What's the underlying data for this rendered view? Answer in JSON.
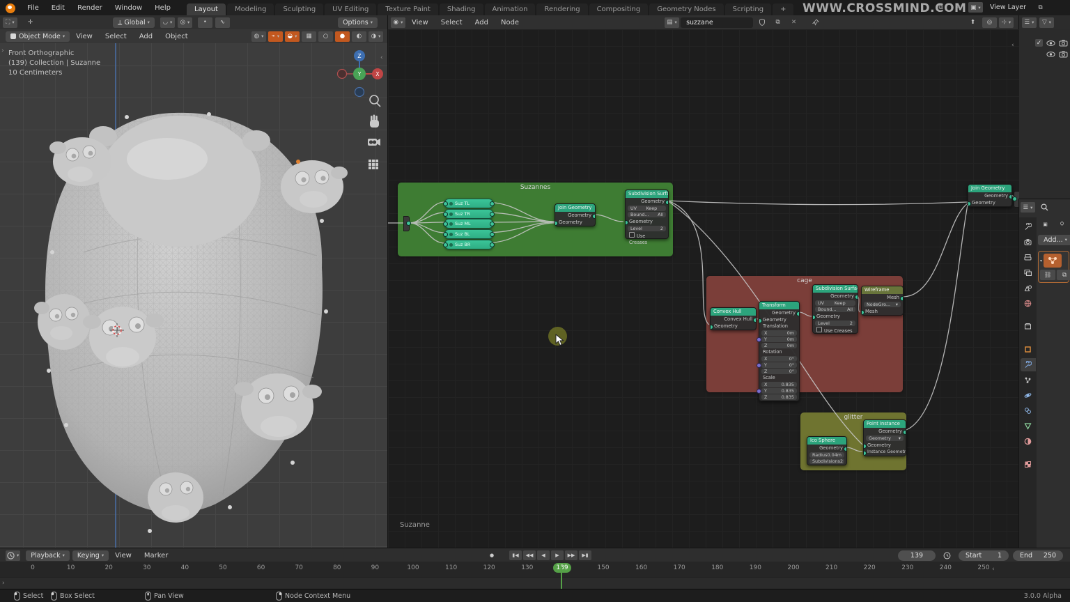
{
  "topbar": {
    "menus": [
      "File",
      "Edit",
      "Render",
      "Window",
      "Help"
    ],
    "tabs": [
      "Layout",
      "Modeling",
      "Sculpting",
      "UV Editing",
      "Texture Paint",
      "Shading",
      "Animation",
      "Rendering",
      "Compositing",
      "Geometry Nodes",
      "Scripting"
    ],
    "active_tab": "Layout",
    "new_tab_label": "+",
    "watermark": "WWW.CROSSMIND.COM",
    "view_layer_label": "View Layer"
  },
  "tool_settings": {
    "orientation": "Global",
    "options_label": "Options"
  },
  "viewport": {
    "mode": "Object Mode",
    "menus": [
      "View",
      "Select",
      "Add",
      "Object"
    ],
    "overlay_lines": [
      "Front Orthographic",
      "(139) Collection | Suzanne",
      "10 Centimeters"
    ],
    "gizmo": {
      "x": "X",
      "y": "Y",
      "z": "Z"
    }
  },
  "node_editor": {
    "menus": [
      "View",
      "Select",
      "Add",
      "Node"
    ],
    "tree_name": "suzzane",
    "object_label": "Suzanne",
    "frames": {
      "suzannes": "Suzannes",
      "cage": "cage",
      "glitter": "glitter"
    },
    "pills": [
      "Suz TL",
      "Suz TR",
      "Suz ML",
      "Suz BL",
      "Suz BR"
    ],
    "join": {
      "title": "Join Geometry",
      "out": "Geometry",
      "in": "Geometry"
    },
    "subdiv": {
      "title": "Subdivision Surface",
      "out": "Geometry",
      "uv_label": "UV Sm...",
      "uv_value": "Keep Bo..",
      "bound_label": "Bound...",
      "bound_value": "All",
      "in": "Geometry",
      "level_label": "Level",
      "level_value": "2",
      "crease_label": "Use Creases"
    },
    "convex": {
      "title": "Convex Hull",
      "out": "Convex Hull",
      "in": "Geometry"
    },
    "transform": {
      "title": "Transform",
      "out": "Geometry",
      "in": "Geometry",
      "sec1": "Translation",
      "sec2": "Rotation",
      "sec3": "Scale",
      "axis": [
        "X",
        "Y",
        "Z"
      ],
      "trans": [
        "0m",
        "0m",
        "0m"
      ],
      "rot": [
        "0°",
        "0°",
        "0°"
      ],
      "scale": [
        "0.835",
        "0.835",
        "0.835"
      ]
    },
    "wireframe": {
      "title": "Wireframe",
      "out": "Mesh",
      "group_value": "NodeGro...",
      "in": "Mesh"
    },
    "ico": {
      "title": "Ico Sphere",
      "out": "Geometry",
      "radius_label": "Radius",
      "radius_value": "0.04m",
      "subd_label": "Subdivisions",
      "subd_value": "2"
    },
    "instance": {
      "title": "Point Instance",
      "out": "Geometry",
      "mode_value": "Geometry",
      "in1": "Geometry",
      "in2": "Instance Geometry"
    }
  },
  "properties": {
    "add_label": "Add..."
  },
  "timeline": {
    "playback_label": "Playback",
    "keying_label": "Keying",
    "menus": [
      "View",
      "Marker"
    ],
    "current_frame": "139",
    "start_label": "Start",
    "start_value": "1",
    "end_label": "End",
    "end_value": "250",
    "ticks": [
      0,
      10,
      20,
      30,
      40,
      50,
      60,
      70,
      80,
      90,
      100,
      110,
      120,
      130,
      150,
      160,
      170,
      180,
      190,
      200,
      210,
      220,
      230,
      240,
      250
    ]
  },
  "statusbar": {
    "hints": [
      "Select",
      "Box Select",
      "Pan View",
      "Node Context Menu"
    ],
    "version": "3.0.0 Alpha"
  },
  "colors": {
    "accent_green": "#55a047",
    "node_header": "#2ca47c",
    "node_header_olive": "#68743a",
    "pill_teal": "#3bc598",
    "frame_green": "#3e7c33",
    "frame_red": "#7b3e39",
    "frame_olive": "#6f7430"
  }
}
